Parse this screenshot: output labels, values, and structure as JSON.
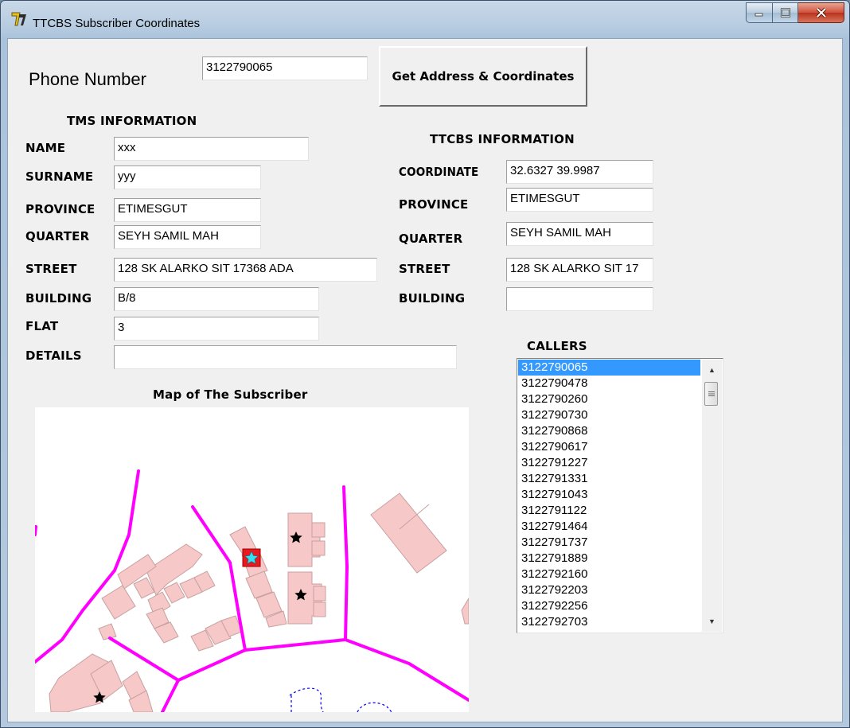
{
  "window": {
    "title": "TTCBS Subscriber Coordinates",
    "app_icon": "yellow-seven-logo-icon",
    "controls": [
      "minimize-icon",
      "maximize-icon",
      "close-icon"
    ]
  },
  "phone": {
    "label": "Phone Number",
    "value": "3122790065",
    "button_label": "Get Address & Coordinates"
  },
  "tms": {
    "heading": "TMS INFORMATION",
    "name_label": "NAME",
    "name": "xxx",
    "surname_label": "SURNAME",
    "surname": "yyy",
    "province_label": "PROVINCE",
    "province": "ETIMESGUT",
    "quarter_label": "QUARTER",
    "quarter": "SEYH SAMIL MAH",
    "street_label": "STREET",
    "street": "128 SK ALARKO SIT 17368 ADA",
    "building_label": "BUILDING",
    "building": "B/8",
    "flat_label": "FLAT",
    "flat": "3",
    "details_label": "DETAILS",
    "details": ""
  },
  "ttcbs": {
    "heading": "TTCBS INFORMATION",
    "coordinate_label": "COORDINATE",
    "coordinate": "32.6327 39.9987",
    "province_label": "PROVINCE",
    "province": "ETIMESGUT",
    "quarter_label": "QUARTER",
    "quarter": "SEYH SAMIL MAH",
    "street_label": "STREET",
    "street": "128 SK ALARKO SIT 17",
    "building_label": "BUILDING",
    "building": ""
  },
  "callers": {
    "heading": "CALLERS",
    "selected": "3122790065",
    "items": [
      "3122790065",
      "3122790478",
      "3122790260",
      "3122790730",
      "3122790868",
      "3122790617",
      "3122791227",
      "3122791331",
      "3122791043",
      "3122791122",
      "3122791464",
      "3122791737",
      "3122791889",
      "3122792160",
      "3122792203",
      "3122792256",
      "3122792703"
    ]
  },
  "map": {
    "heading": "Map of The Subscriber",
    "road_color": "#ff00ff",
    "building_fill": "#f6c8c8",
    "building_stroke": "#c9a0a0",
    "highlight_fill": "#e8191f",
    "subscriber_marker": "cyan-star-icon",
    "neighbor_marker": "black-star-icon",
    "boundary_color": "#0000ff"
  }
}
